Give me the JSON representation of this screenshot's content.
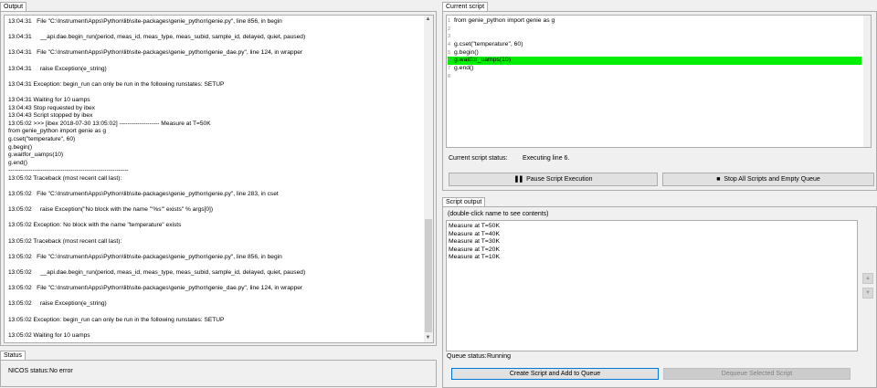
{
  "output": {
    "tab_label": "Output",
    "lines": [
      "13:04:31   File \"C:\\Instrument\\Apps\\Python\\lib\\site-packages\\genie_python\\genie.py\", line 856, in begin",
      "",
      "13:04:31     __api.dae.begin_run(period, meas_id, meas_type, meas_subid, sample_id, delayed, quiet, paused)",
      "",
      "13:04:31   File \"C:\\Instrument\\Apps\\Python\\lib\\site-packages\\genie_python\\genie_dae.py\", line 124, in wrapper",
      "",
      "13:04:31     raise Exception(e_string)",
      "",
      "13:04:31 Exception: begin_run can only be run in the following runstates: SETUP",
      "",
      "13:04:31 Waiting for 10 uamps",
      "13:04:43 Stop requested by ibex",
      "13:04:43 Script stopped by ibex",
      "13:05:02 >>> [ibex 2018-07-30 13:05:02] -------------------- Measure at T=50K",
      "from genie_python import genie as g",
      "g.cset(\"temperature\", 60)",
      "g.begin()",
      "g.waitfor_uamps(10)",
      "g.end()",
      "------------------------------------------------------------",
      "13:05:02 Traceback (most recent call last):",
      "",
      "13:05:02   File \"C:\\Instrument\\Apps\\Python\\lib\\site-packages\\genie_python\\genie.py\", line 283, in cset",
      "",
      "13:05:02     raise Exception(\"No block with the name '\"%s\"' exists\" % args[0])",
      "",
      "13:05:02 Exception: No block with the name \"temperature\" exists",
      "",
      "13:05:02 Traceback (most recent call last):",
      "",
      "13:05:02   File \"C:\\Instrument\\Apps\\Python\\lib\\site-packages\\genie_python\\genie.py\", line 856, in begin",
      "",
      "13:05:02     __api.dae.begin_run(period, meas_id, meas_type, meas_subid, sample_id, delayed, quiet, paused)",
      "",
      "13:05:02   File \"C:\\Instrument\\Apps\\Python\\lib\\site-packages\\genie_python\\genie_dae.py\", line 124, in wrapper",
      "",
      "13:05:02     raise Exception(e_string)",
      "",
      "13:05:02 Exception: begin_run can only be run in the following runstates: SETUP",
      "",
      "13:05:02 Waiting for 10 uamps"
    ]
  },
  "status": {
    "tab_label": "Status",
    "nicos_label": "NICOS status:",
    "nicos_value": "No error"
  },
  "current_script": {
    "tab_label": "Current script",
    "line_numbers": [
      "1",
      "2",
      "3",
      "4",
      "5",
      "6",
      "7",
      "8"
    ],
    "lines": [
      "from genie_python import genie as g",
      "",
      "",
      "g.cset(\"temperature\", 60)",
      "g.begin()",
      "g.waitfor_uamps(10)",
      "g.end()",
      ""
    ],
    "highlighted_line": 6,
    "highlight_color": "#00ee00",
    "status_label": "Current script status:",
    "status_value": "Executing line 6.",
    "pause_label": "Pause Script Execution",
    "stop_label": "Stop All Scripts and Empty Queue"
  },
  "script_output": {
    "tab_label": "Script output",
    "hint": "(double-click name to see contents)",
    "items": [
      "Measure at T=50K",
      "Measure at T=40K",
      "Measure at T=30K",
      "Measure at T=20K",
      "Measure at T=10K"
    ],
    "queue_label": "Queue status:",
    "queue_value": "Running",
    "create_label": "Create Script and Add to Queue",
    "dequeue_label": "Dequeue Selected Script"
  }
}
